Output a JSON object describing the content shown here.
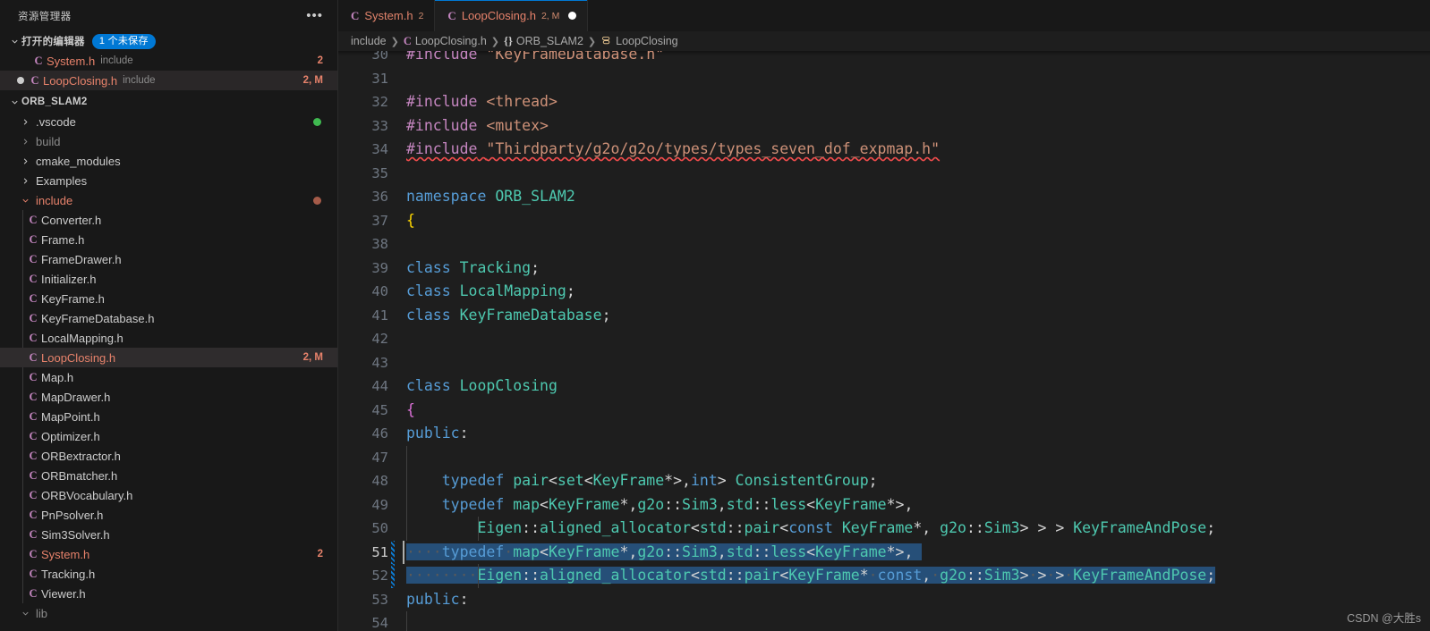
{
  "sidebar": {
    "header_title": "资源管理器",
    "more_icon": "ellipsis-icon",
    "open_editors": {
      "label": "打开的编辑器",
      "badge": "1 个未保存",
      "items": [
        {
          "name": "System.h",
          "folder": "include",
          "deco": "2",
          "icon": "C",
          "modified": false
        },
        {
          "name": "LoopClosing.h",
          "folder": "include",
          "deco": "2, M",
          "icon": "C",
          "modified": true
        }
      ]
    },
    "project": {
      "label": "ORB_SLAM2",
      "folders": [
        {
          "name": ".vscode",
          "expanded": false,
          "dot": "#3fb950"
        },
        {
          "name": "build",
          "expanded": false,
          "dimmed": true
        },
        {
          "name": "cmake_modules",
          "expanded": false
        },
        {
          "name": "Examples",
          "expanded": false
        },
        {
          "name": "include",
          "expanded": true,
          "dot": "#a55b49",
          "modified": true
        }
      ],
      "include_files": [
        {
          "name": "Converter.h",
          "icon": "C"
        },
        {
          "name": "Frame.h",
          "icon": "C"
        },
        {
          "name": "FrameDrawer.h",
          "icon": "C"
        },
        {
          "name": "Initializer.h",
          "icon": "C"
        },
        {
          "name": "KeyFrame.h",
          "icon": "C"
        },
        {
          "name": "KeyFrameDatabase.h",
          "icon": "C"
        },
        {
          "name": "LocalMapping.h",
          "icon": "C"
        },
        {
          "name": "LoopClosing.h",
          "icon": "C",
          "deco": "2, M",
          "selected": true,
          "modified": true
        },
        {
          "name": "Map.h",
          "icon": "C"
        },
        {
          "name": "MapDrawer.h",
          "icon": "C"
        },
        {
          "name": "MapPoint.h",
          "icon": "C"
        },
        {
          "name": "Optimizer.h",
          "icon": "C"
        },
        {
          "name": "ORBextractor.h",
          "icon": "C"
        },
        {
          "name": "ORBmatcher.h",
          "icon": "C"
        },
        {
          "name": "ORBVocabulary.h",
          "icon": "C"
        },
        {
          "name": "PnPsolver.h",
          "icon": "C"
        },
        {
          "name": "Sim3Solver.h",
          "icon": "C"
        },
        {
          "name": "System.h",
          "icon": "C",
          "deco": "2",
          "modified": true
        },
        {
          "name": "Tracking.h",
          "icon": "C"
        },
        {
          "name": "Viewer.h",
          "icon": "C"
        }
      ],
      "trailing_folders": [
        {
          "name": "lib",
          "expanded": true
        }
      ]
    }
  },
  "tabs": [
    {
      "icon": "C",
      "name": "System.h",
      "count": "2",
      "dirty": false,
      "active": false
    },
    {
      "icon": "C",
      "name": "LoopClosing.h",
      "count": "2, M",
      "dirty": true,
      "active": true
    }
  ],
  "breadcrumb": [
    {
      "label": "include",
      "icon": ""
    },
    {
      "label": "LoopClosing.h",
      "icon": "C"
    },
    {
      "label": "ORB_SLAM2",
      "icon": "{}"
    },
    {
      "label": "LoopClosing",
      "icon": "class-icon"
    }
  ],
  "editor": {
    "first_visible_line": 30,
    "cursor_line": 51,
    "selected_lines": [
      51,
      52
    ],
    "lines": [
      {
        "n": 30,
        "text": "#include \"KeyFrameDatabase.h\"",
        "clipped": true
      },
      {
        "n": 31,
        "text": ""
      },
      {
        "n": 32,
        "text": "#include <thread>"
      },
      {
        "n": 33,
        "text": "#include <mutex>"
      },
      {
        "n": 34,
        "text": "#include \"Thirdparty/g2o/g2o/types/types_seven_dof_expmap.h\"",
        "error": true
      },
      {
        "n": 35,
        "text": ""
      },
      {
        "n": 36,
        "text": "namespace ORB_SLAM2"
      },
      {
        "n": 37,
        "text": "{"
      },
      {
        "n": 38,
        "text": ""
      },
      {
        "n": 39,
        "text": "class Tracking;"
      },
      {
        "n": 40,
        "text": "class LocalMapping;"
      },
      {
        "n": 41,
        "text": "class KeyFrameDatabase;"
      },
      {
        "n": 42,
        "text": ""
      },
      {
        "n": 43,
        "text": ""
      },
      {
        "n": 44,
        "text": "class LoopClosing"
      },
      {
        "n": 45,
        "text": "{"
      },
      {
        "n": 46,
        "text": "public:"
      },
      {
        "n": 47,
        "text": ""
      },
      {
        "n": 48,
        "text": "    typedef pair<set<KeyFrame*>,int> ConsistentGroup;"
      },
      {
        "n": 49,
        "text": "    typedef map<KeyFrame*,g2o::Sim3,std::less<KeyFrame*>,"
      },
      {
        "n": 50,
        "text": "        Eigen::aligned_allocator<std::pair<const KeyFrame*, g2o::Sim3> > > KeyFrameAndPose;"
      },
      {
        "n": 51,
        "text": "    typedef map<KeyFrame*,g2o::Sim3,std::less<KeyFrame*>,",
        "selected": true
      },
      {
        "n": 52,
        "text": "        Eigen::aligned_allocator<std::pair<KeyFrame* const, g2o::Sim3> > > KeyFrameAndPose;",
        "selected": true
      },
      {
        "n": 53,
        "text": "public:"
      },
      {
        "n": 54,
        "text": "",
        "clipped": true
      }
    ]
  },
  "watermark": "CSDN @大胜s",
  "colors": {
    "accent": "#0078d4",
    "selection": "#264f78",
    "modified_file": "#e7826b",
    "keyword": "#569cd6",
    "type": "#4ec9b0",
    "preprocessor": "#c586c0",
    "string": "#ce9178",
    "error_squiggle": "#f14c4c"
  }
}
